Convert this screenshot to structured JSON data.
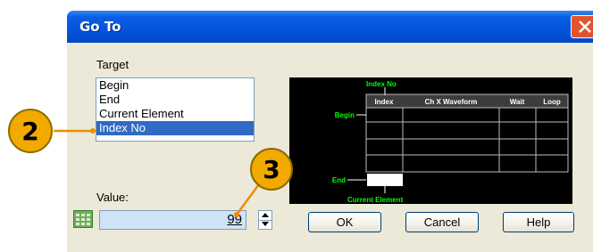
{
  "dialog": {
    "title": "Go To",
    "close_icon": "close-x-icon"
  },
  "target": {
    "label": "Target",
    "items": [
      "Begin",
      "End",
      "Current Element",
      "Index No"
    ],
    "selected_index": 3
  },
  "preview": {
    "index_no_label": "Index No",
    "begin_label": "Begin",
    "end_label": "End",
    "current_element_label": "Current Element",
    "columns": [
      "Index",
      "Ch X Waveform",
      "Wait",
      "Loop"
    ]
  },
  "value": {
    "label": "Value:",
    "current": "99",
    "icon": "calculator-keypad-icon"
  },
  "buttons": {
    "ok": "OK",
    "cancel": "Cancel",
    "help": "Help"
  },
  "callouts": [
    "2",
    "3"
  ],
  "colors": {
    "titlebar": "#0454dc",
    "dialog_bg": "#ece9d8",
    "selection": "#316ac5",
    "callout_fill": "#f2a900",
    "callout_line": "#f08c00",
    "preview_accent": "#00ff00"
  }
}
